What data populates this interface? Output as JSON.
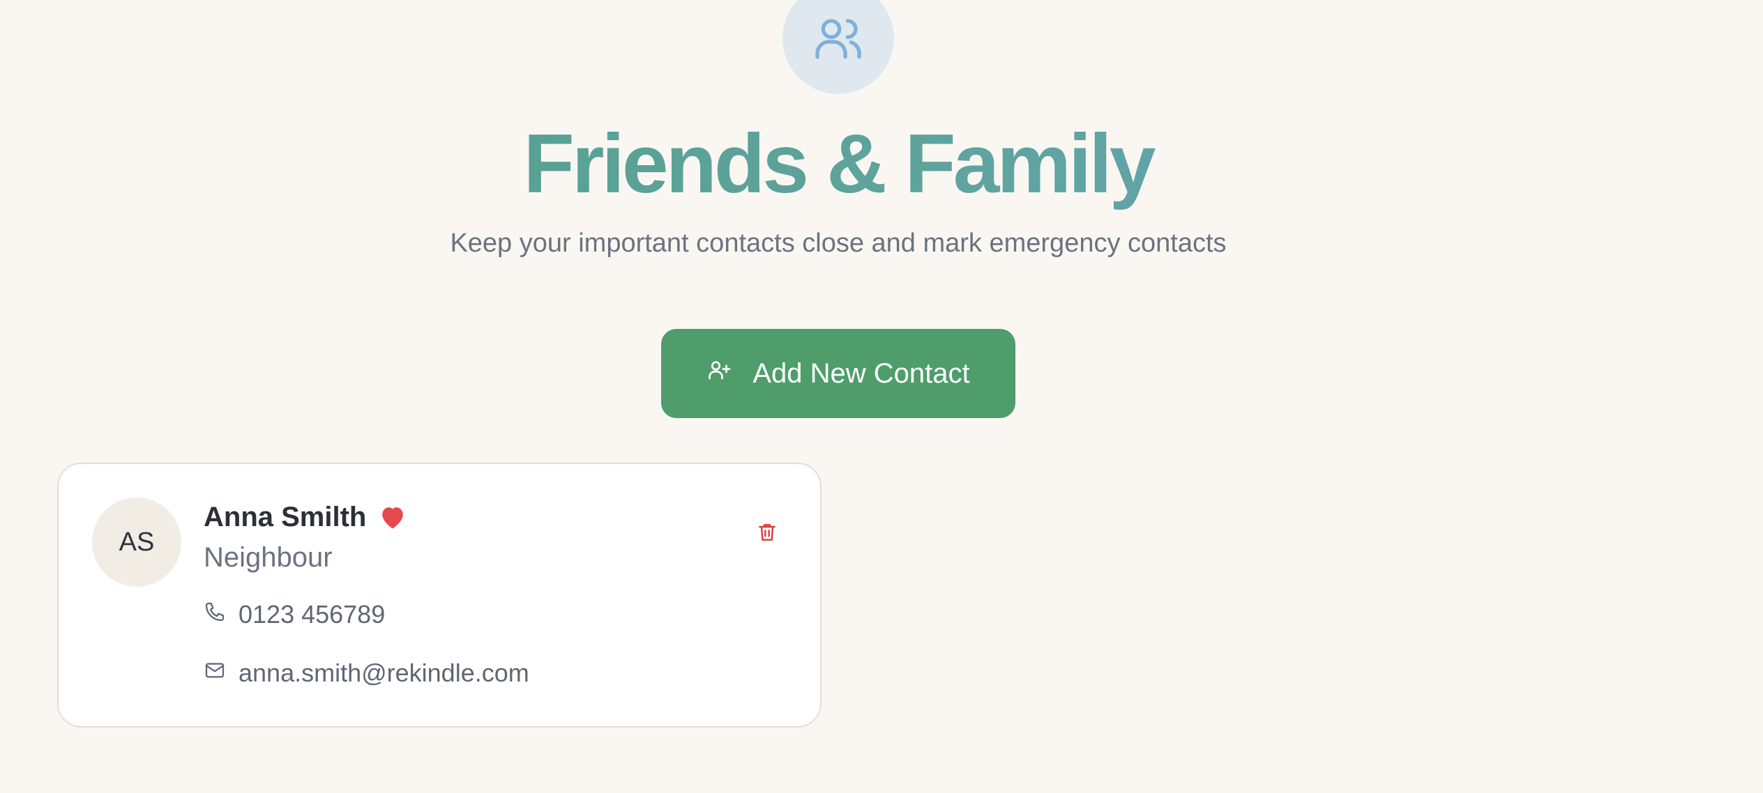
{
  "header": {
    "icon": "users-icon",
    "title": "Friends & Family",
    "subtitle": "Keep your important contacts close and mark emergency contacts"
  },
  "add_button": {
    "label": "Add New Contact",
    "icon": "user-plus-icon"
  },
  "colors": {
    "background": "#faf7f3",
    "primary_button": "#4e9d6b",
    "title_gradient_start": "#4f9f86",
    "title_gradient_end": "#67a8bd",
    "emergency_heart": "#e5484d",
    "delete_icon": "#d93b3b"
  },
  "contacts": [
    {
      "initials": "AS",
      "name": "Anna Smilth",
      "relationship": "Neighbour",
      "phone": "0123 456789",
      "email": "anna.smith@rekindle.com",
      "emergency_icon": "heart-icon",
      "delete_icon": "trash-icon"
    }
  ]
}
